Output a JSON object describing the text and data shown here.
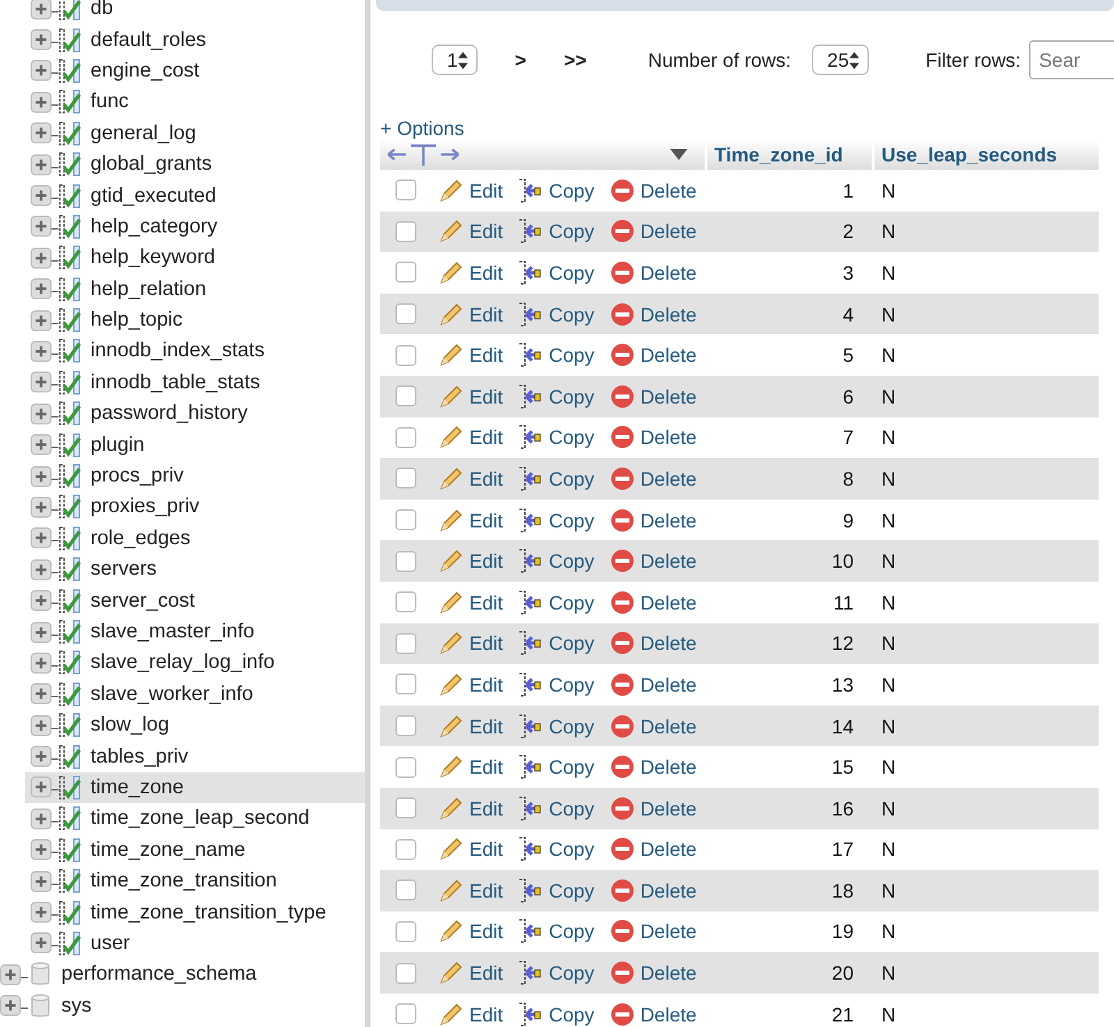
{
  "sidebar": {
    "tables": [
      {
        "name": "db",
        "selected": false,
        "expanded": false
      },
      {
        "name": "default_roles",
        "selected": false,
        "expanded": false
      },
      {
        "name": "engine_cost",
        "selected": false,
        "expanded": false
      },
      {
        "name": "func",
        "selected": false,
        "expanded": false
      },
      {
        "name": "general_log",
        "selected": false,
        "expanded": false
      },
      {
        "name": "global_grants",
        "selected": false,
        "expanded": false
      },
      {
        "name": "gtid_executed",
        "selected": false,
        "expanded": false
      },
      {
        "name": "help_category",
        "selected": false,
        "expanded": false
      },
      {
        "name": "help_keyword",
        "selected": false,
        "expanded": false
      },
      {
        "name": "help_relation",
        "selected": false,
        "expanded": false
      },
      {
        "name": "help_topic",
        "selected": false,
        "expanded": false
      },
      {
        "name": "innodb_index_stats",
        "selected": false,
        "expanded": false
      },
      {
        "name": "innodb_table_stats",
        "selected": false,
        "expanded": false
      },
      {
        "name": "password_history",
        "selected": false,
        "expanded": false
      },
      {
        "name": "plugin",
        "selected": false,
        "expanded": false
      },
      {
        "name": "procs_priv",
        "selected": false,
        "expanded": false
      },
      {
        "name": "proxies_priv",
        "selected": false,
        "expanded": false
      },
      {
        "name": "role_edges",
        "selected": false,
        "expanded": false
      },
      {
        "name": "servers",
        "selected": false,
        "expanded": false
      },
      {
        "name": "server_cost",
        "selected": false,
        "expanded": false
      },
      {
        "name": "slave_master_info",
        "selected": false,
        "expanded": false
      },
      {
        "name": "slave_relay_log_info",
        "selected": false,
        "expanded": false
      },
      {
        "name": "slave_worker_info",
        "selected": false,
        "expanded": false
      },
      {
        "name": "slow_log",
        "selected": false,
        "expanded": false
      },
      {
        "name": "tables_priv",
        "selected": false,
        "expanded": false
      },
      {
        "name": "time_zone",
        "selected": true,
        "expanded": false
      },
      {
        "name": "time_zone_leap_second",
        "selected": false,
        "expanded": false
      },
      {
        "name": "time_zone_name",
        "selected": false,
        "expanded": false
      },
      {
        "name": "time_zone_transition",
        "selected": false,
        "expanded": false
      },
      {
        "name": "time_zone_transition_type",
        "selected": false,
        "expanded": false
      },
      {
        "name": "user",
        "selected": false,
        "expanded": false
      }
    ],
    "databases": [
      {
        "name": "performance_schema",
        "expanded": false
      },
      {
        "name": "sys",
        "expanded": false
      }
    ]
  },
  "pagination": {
    "page": "1",
    "next": ">",
    "last": ">>",
    "rows_label": "Number of rows:",
    "rows": "25",
    "filter_label": "Filter rows:",
    "filter_placeholder": "Sear"
  },
  "options_link": "+ Options",
  "table": {
    "columns": [
      "Time_zone_id",
      "Use_leap_seconds"
    ],
    "rows": [
      {
        "checked": false,
        "actions": [
          "Edit",
          "Copy",
          "Delete"
        ],
        "cells": [
          "1",
          "N"
        ]
      },
      {
        "checked": false,
        "actions": [
          "Edit",
          "Copy",
          "Delete"
        ],
        "cells": [
          "2",
          "N"
        ]
      },
      {
        "checked": false,
        "actions": [
          "Edit",
          "Copy",
          "Delete"
        ],
        "cells": [
          "3",
          "N"
        ]
      },
      {
        "checked": false,
        "actions": [
          "Edit",
          "Copy",
          "Delete"
        ],
        "cells": [
          "4",
          "N"
        ]
      },
      {
        "checked": false,
        "actions": [
          "Edit",
          "Copy",
          "Delete"
        ],
        "cells": [
          "5",
          "N"
        ]
      },
      {
        "checked": false,
        "actions": [
          "Edit",
          "Copy",
          "Delete"
        ],
        "cells": [
          "6",
          "N"
        ]
      },
      {
        "checked": false,
        "actions": [
          "Edit",
          "Copy",
          "Delete"
        ],
        "cells": [
          "7",
          "N"
        ]
      },
      {
        "checked": false,
        "actions": [
          "Edit",
          "Copy",
          "Delete"
        ],
        "cells": [
          "8",
          "N"
        ]
      },
      {
        "checked": false,
        "actions": [
          "Edit",
          "Copy",
          "Delete"
        ],
        "cells": [
          "9",
          "N"
        ]
      },
      {
        "checked": false,
        "actions": [
          "Edit",
          "Copy",
          "Delete"
        ],
        "cells": [
          "10",
          "N"
        ]
      },
      {
        "checked": false,
        "actions": [
          "Edit",
          "Copy",
          "Delete"
        ],
        "cells": [
          "11",
          "N"
        ]
      },
      {
        "checked": false,
        "actions": [
          "Edit",
          "Copy",
          "Delete"
        ],
        "cells": [
          "12",
          "N"
        ]
      },
      {
        "checked": false,
        "actions": [
          "Edit",
          "Copy",
          "Delete"
        ],
        "cells": [
          "13",
          "N"
        ]
      },
      {
        "checked": false,
        "actions": [
          "Edit",
          "Copy",
          "Delete"
        ],
        "cells": [
          "14",
          "N"
        ]
      },
      {
        "checked": false,
        "actions": [
          "Edit",
          "Copy",
          "Delete"
        ],
        "cells": [
          "15",
          "N"
        ]
      },
      {
        "checked": false,
        "actions": [
          "Edit",
          "Copy",
          "Delete"
        ],
        "cells": [
          "16",
          "N"
        ]
      },
      {
        "checked": false,
        "actions": [
          "Edit",
          "Copy",
          "Delete"
        ],
        "cells": [
          "17",
          "N"
        ]
      },
      {
        "checked": false,
        "actions": [
          "Edit",
          "Copy",
          "Delete"
        ],
        "cells": [
          "18",
          "N"
        ]
      },
      {
        "checked": false,
        "actions": [
          "Edit",
          "Copy",
          "Delete"
        ],
        "cells": [
          "19",
          "N"
        ]
      },
      {
        "checked": false,
        "actions": [
          "Edit",
          "Copy",
          "Delete"
        ],
        "cells": [
          "20",
          "N"
        ]
      },
      {
        "checked": false,
        "actions": [
          "Edit",
          "Copy",
          "Delete"
        ],
        "cells": [
          "21",
          "N"
        ]
      }
    ]
  }
}
